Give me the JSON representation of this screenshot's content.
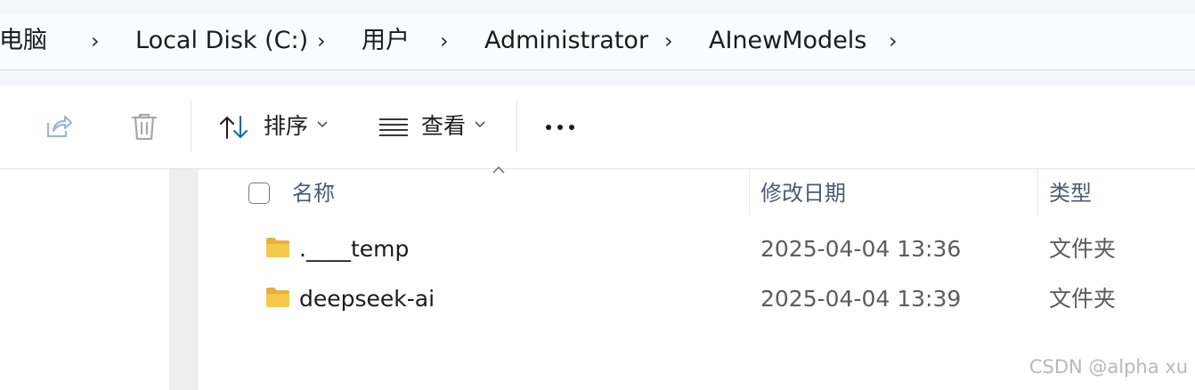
{
  "breadcrumb": {
    "items": [
      "此电脑",
      "Local Disk (C:)",
      "用户",
      "Administrator",
      "AInewModels"
    ]
  },
  "toolbar": {
    "share_icon": "share-icon",
    "delete_icon": "trash-icon",
    "sort_label": "排序",
    "view_label": "查看",
    "more_label": "•••"
  },
  "columns": {
    "name": "名称",
    "modified": "修改日期",
    "type": "类型"
  },
  "files": [
    {
      "name": ".____temp",
      "modified": "2025-04-04 13:36",
      "type": "文件夹"
    },
    {
      "name": "deepseek-ai",
      "modified": "2025-04-04 13:39",
      "type": "文件夹"
    }
  ],
  "watermark": "CSDN @alpha xu",
  "colors": {
    "accent": "#0067c0",
    "folder": "#f7c948",
    "header_text": "#4d5b6e"
  }
}
